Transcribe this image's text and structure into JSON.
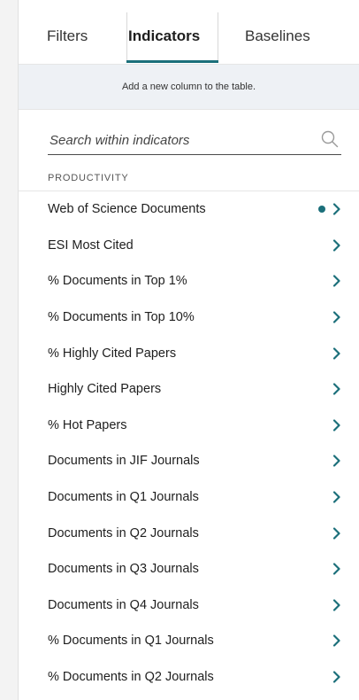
{
  "tabs": [
    {
      "label": "Filters"
    },
    {
      "label": "Indicators"
    },
    {
      "label": "Baselines"
    }
  ],
  "hint": "Add a new column to the table.",
  "search": {
    "placeholder": "Search within indicators"
  },
  "section": {
    "title": "PRODUCTIVITY"
  },
  "items": [
    {
      "label": "Web of Science Documents",
      "selected": true
    },
    {
      "label": "ESI Most Cited"
    },
    {
      "label": "% Documents in Top 1%"
    },
    {
      "label": "% Documents in Top 10%"
    },
    {
      "label": "% Highly Cited Papers"
    },
    {
      "label": "Highly Cited Papers"
    },
    {
      "label": "% Hot Papers"
    },
    {
      "label": "Documents in JIF Journals"
    },
    {
      "label": "Documents in Q1 Journals"
    },
    {
      "label": "Documents in Q2 Journals"
    },
    {
      "label": "Documents in Q3 Journals"
    },
    {
      "label": "Documents in Q4 Journals"
    },
    {
      "label": "% Documents in Q1 Journals"
    },
    {
      "label": "% Documents in Q2 Journals"
    }
  ],
  "colors": {
    "accent": "#1b6f7a"
  }
}
